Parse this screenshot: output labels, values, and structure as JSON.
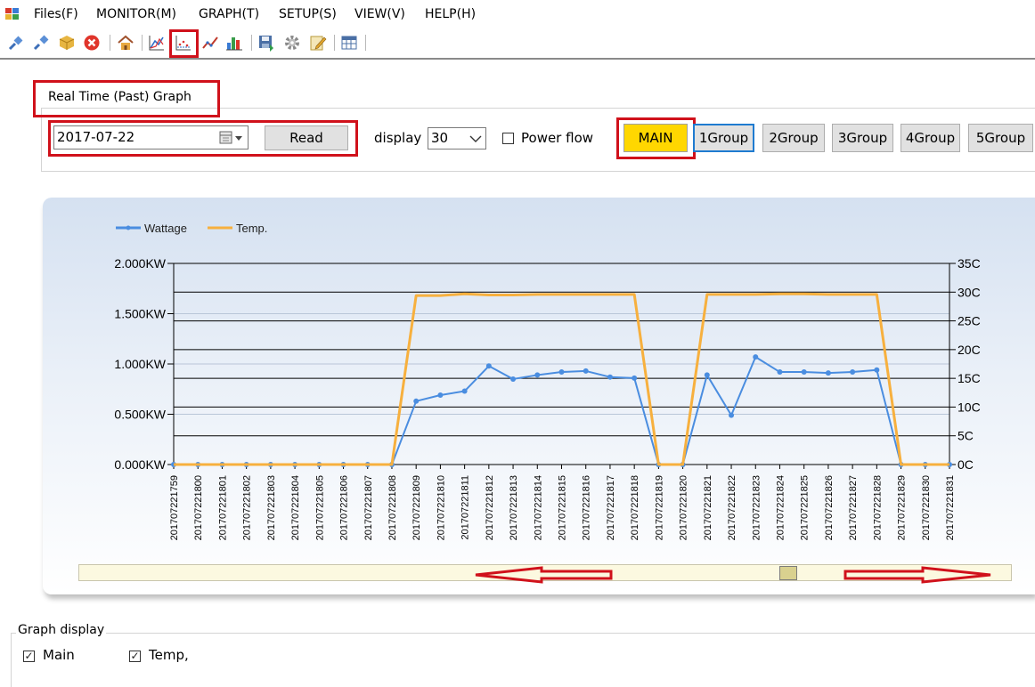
{
  "menu": {
    "items": [
      "Files(F)",
      "MONITOR(M)",
      "GRAPH(T)",
      "SETUP(S)",
      "VIEW(V)",
      "HELP(H)"
    ]
  },
  "toolbar": {
    "icons": [
      "connect-icon",
      "disconnect-icon",
      "package-icon",
      "close-circle-icon",
      "home-icon",
      "area-chart-icon",
      "line-graph-icon",
      "trend-line-icon",
      "bar-chart-icon",
      "save-icon",
      "gear-icon",
      "edit-icon",
      "table-icon"
    ],
    "selected": "line-graph-icon"
  },
  "panel": {
    "title": "Real Time (Past) Graph",
    "date_value": "2017-07-22",
    "read_label": "Read",
    "display_label": "display",
    "display_value": "30",
    "powerflow_label": "Power flow",
    "powerflow_checked": false,
    "groups": [
      "MAIN",
      "1Group",
      "2Group",
      "3Group",
      "4Group",
      "5Group"
    ],
    "selected_group": "MAIN"
  },
  "graph_display": {
    "title": "Graph display",
    "main_label": "Main",
    "main_checked": true,
    "temp_label": "Temp,",
    "temp_checked": true
  },
  "colors": {
    "wattage": "#4a8de0",
    "temp": "#f7b03e",
    "highlight_red": "#d0111b",
    "main_button_bg": "#ffd700"
  },
  "chart_data": {
    "type": "line",
    "legend": [
      "Wattage",
      "Temp."
    ],
    "legend_placement": "top-left",
    "categories": [
      "201707221759",
      "201707221800",
      "201707221801",
      "201707221802",
      "201707221803",
      "201707221804",
      "201707221805",
      "201707221806",
      "201707221807",
      "201707221808",
      "201707221809",
      "201707221810",
      "201707221811",
      "201707221812",
      "201707221813",
      "201707221814",
      "201707221815",
      "201707221816",
      "201707221817",
      "201707221818",
      "201707221819",
      "201707221820",
      "201707221821",
      "201707221822",
      "201707221823",
      "201707221824",
      "201707221825",
      "201707221826",
      "201707221827",
      "201707221828",
      "201707221829",
      "201707221830",
      "201707221831"
    ],
    "y_left": {
      "ticks": [
        "0.000KW",
        "0.500KW",
        "1.000KW",
        "1.500KW",
        "2.000KW"
      ],
      "ylim": [
        0,
        2.0
      ]
    },
    "y_right": {
      "ticks": [
        "0C",
        "5C",
        "10C",
        "15C",
        "20C",
        "25C",
        "30C",
        "35C"
      ],
      "ylim": [
        0,
        35
      ]
    },
    "series": [
      {
        "name": "Wattage",
        "axis": "left",
        "markers": true,
        "values": [
          0,
          0,
          0,
          0,
          0,
          0,
          0,
          0,
          0,
          0,
          0.63,
          0.69,
          0.73,
          0.98,
          0.85,
          0.89,
          0.92,
          0.93,
          0.87,
          0.86,
          0,
          0,
          0.89,
          0.49,
          1.07,
          0.92,
          0.92,
          0.91,
          0.92,
          0.94,
          0,
          0,
          0
        ]
      },
      {
        "name": "Temp.",
        "axis": "right",
        "markers": false,
        "values": [
          0,
          0,
          0,
          0,
          0,
          0,
          0,
          0,
          0,
          0,
          29.4,
          29.4,
          29.7,
          29.5,
          29.5,
          29.6,
          29.6,
          29.6,
          29.6,
          29.6,
          0,
          0,
          29.6,
          29.6,
          29.6,
          29.7,
          29.7,
          29.6,
          29.6,
          29.6,
          0,
          0,
          0
        ]
      }
    ]
  }
}
